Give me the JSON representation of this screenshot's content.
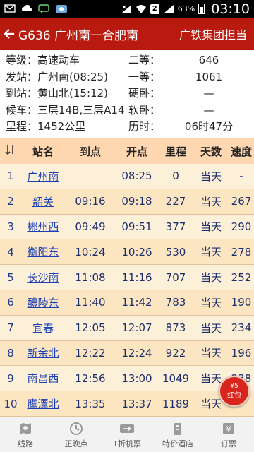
{
  "status_bar": {
    "battery": "63%",
    "time": "03:10",
    "badge": "2"
  },
  "header": {
    "title": "G636 广州南一合肥南",
    "right": "广铁集团担当"
  },
  "info": {
    "grade_label": "等级：",
    "grade_value": "高速动车",
    "second_label": "二等：",
    "second_value": "646",
    "depart_label": "发站：",
    "depart_value": "广州南(08:25)",
    "first_label": "一等：",
    "first_value": "1061",
    "arrive_label": "到站：",
    "arrive_value": "黄山北(15:12)",
    "hard_sleeper_label": "硬卧：",
    "hard_sleeper_value": "—",
    "waiting_label": "候车：",
    "waiting_value": "三层14B,三层A14",
    "soft_sleeper_label": "软卧：",
    "soft_sleeper_value": "—",
    "distance_label": "里程：",
    "distance_value": "1452公里",
    "duration_label": "历时：",
    "duration_value": "06时47分"
  },
  "table": {
    "headers": {
      "sort": "↓⇂",
      "station": "站名",
      "arrive": "到点",
      "depart": "开点",
      "distance": "里程",
      "days": "天数",
      "speed": "速度"
    },
    "rows": [
      {
        "no": "1",
        "station": "广州南",
        "arrive": "",
        "depart": "08:25",
        "distance": "0",
        "days": "当天",
        "speed": "-"
      },
      {
        "no": "2",
        "station": "韶关",
        "arrive": "09:16",
        "depart": "09:18",
        "distance": "227",
        "days": "当天",
        "speed": "267"
      },
      {
        "no": "3",
        "station": "郴州西",
        "arrive": "09:49",
        "depart": "09:51",
        "distance": "377",
        "days": "当天",
        "speed": "290"
      },
      {
        "no": "4",
        "station": "衡阳东",
        "arrive": "10:24",
        "depart": "10:26",
        "distance": "530",
        "days": "当天",
        "speed": "278"
      },
      {
        "no": "5",
        "station": "长沙南",
        "arrive": "11:08",
        "depart": "11:16",
        "distance": "707",
        "days": "当天",
        "speed": "252"
      },
      {
        "no": "6",
        "station": "醴陵东",
        "arrive": "11:40",
        "depart": "11:42",
        "distance": "783",
        "days": "当天",
        "speed": "190"
      },
      {
        "no": "7",
        "station": "宜春",
        "arrive": "12:05",
        "depart": "12:07",
        "distance": "873",
        "days": "当天",
        "speed": "234"
      },
      {
        "no": "8",
        "station": "新余北",
        "arrive": "12:22",
        "depart": "12:24",
        "distance": "922",
        "days": "当天",
        "speed": "196"
      },
      {
        "no": "9",
        "station": "南昌西",
        "arrive": "12:56",
        "depart": "13:00",
        "distance": "1049",
        "days": "当天",
        "speed": "238"
      },
      {
        "no": "10",
        "station": "鹰潭北",
        "arrive": "13:35",
        "depart": "13:37",
        "distance": "1189",
        "days": "当天",
        "speed": ""
      }
    ]
  },
  "badge": {
    "top": "¥5",
    "label": "红包"
  },
  "bottom_nav": [
    {
      "label": "线路",
      "icon": "map-icon"
    },
    {
      "label": "正晚点",
      "icon": "clock-icon"
    },
    {
      "label": "1折机票",
      "icon": "plane-ticket-icon"
    },
    {
      "label": "特价酒店",
      "icon": "hotel-icon"
    },
    {
      "label": "订票",
      "icon": "ticket-icon"
    }
  ],
  "colors": {
    "header_bg": "#b81a0f",
    "table_header_bg": "#ffd7b0",
    "row_odd": "#fdf0d8",
    "row_even": "#fce6c2",
    "station_link": "#1a3fb8"
  }
}
